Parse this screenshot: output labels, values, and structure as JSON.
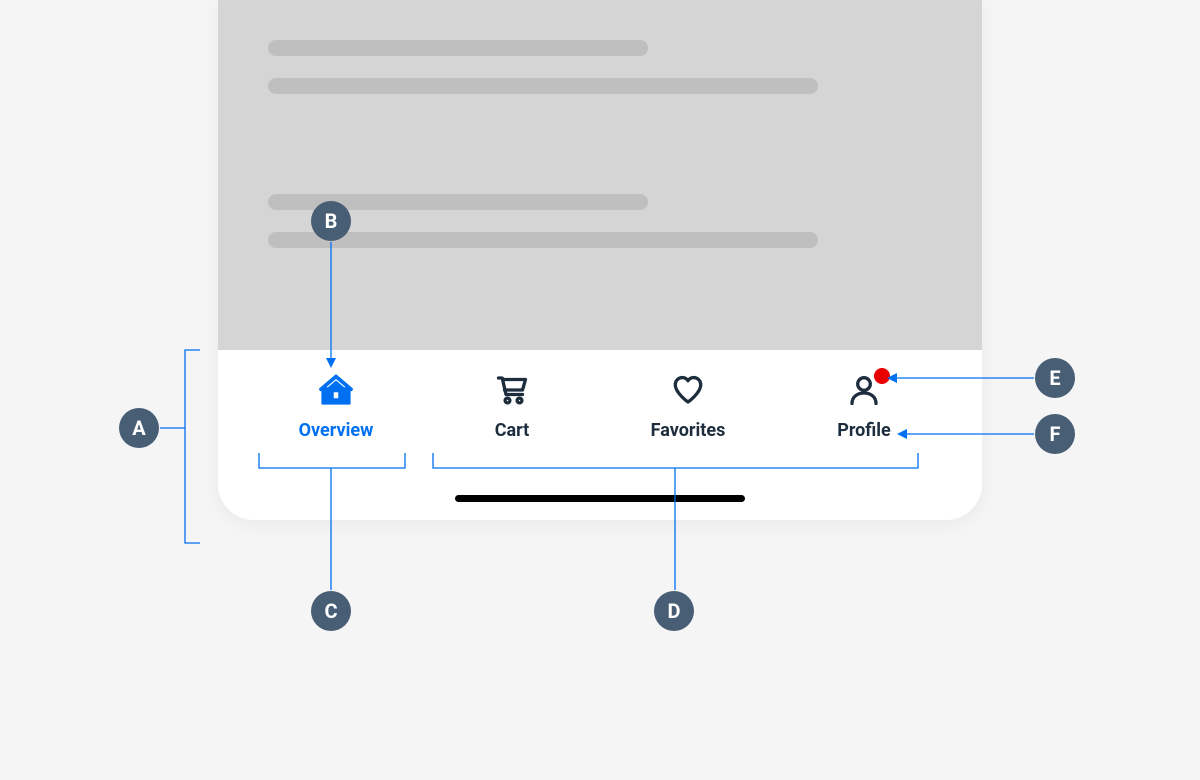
{
  "tabbar": {
    "items": [
      {
        "label": "Overview",
        "icon": "home-icon",
        "active": true,
        "badge": false
      },
      {
        "label": "Cart",
        "icon": "cart-icon",
        "active": false,
        "badge": false
      },
      {
        "label": "Favorites",
        "icon": "heart-icon",
        "active": false,
        "badge": false
      },
      {
        "label": "Profile",
        "icon": "user-icon",
        "active": false,
        "badge": true
      }
    ]
  },
  "annotations": {
    "A": "A",
    "B": "B",
    "C": "C",
    "D": "D",
    "E": "E",
    "F": "F"
  },
  "colors": {
    "accent": "#0070f2",
    "slate": "#475e75",
    "text": "#1d2d3e",
    "badge": "#e90000"
  }
}
